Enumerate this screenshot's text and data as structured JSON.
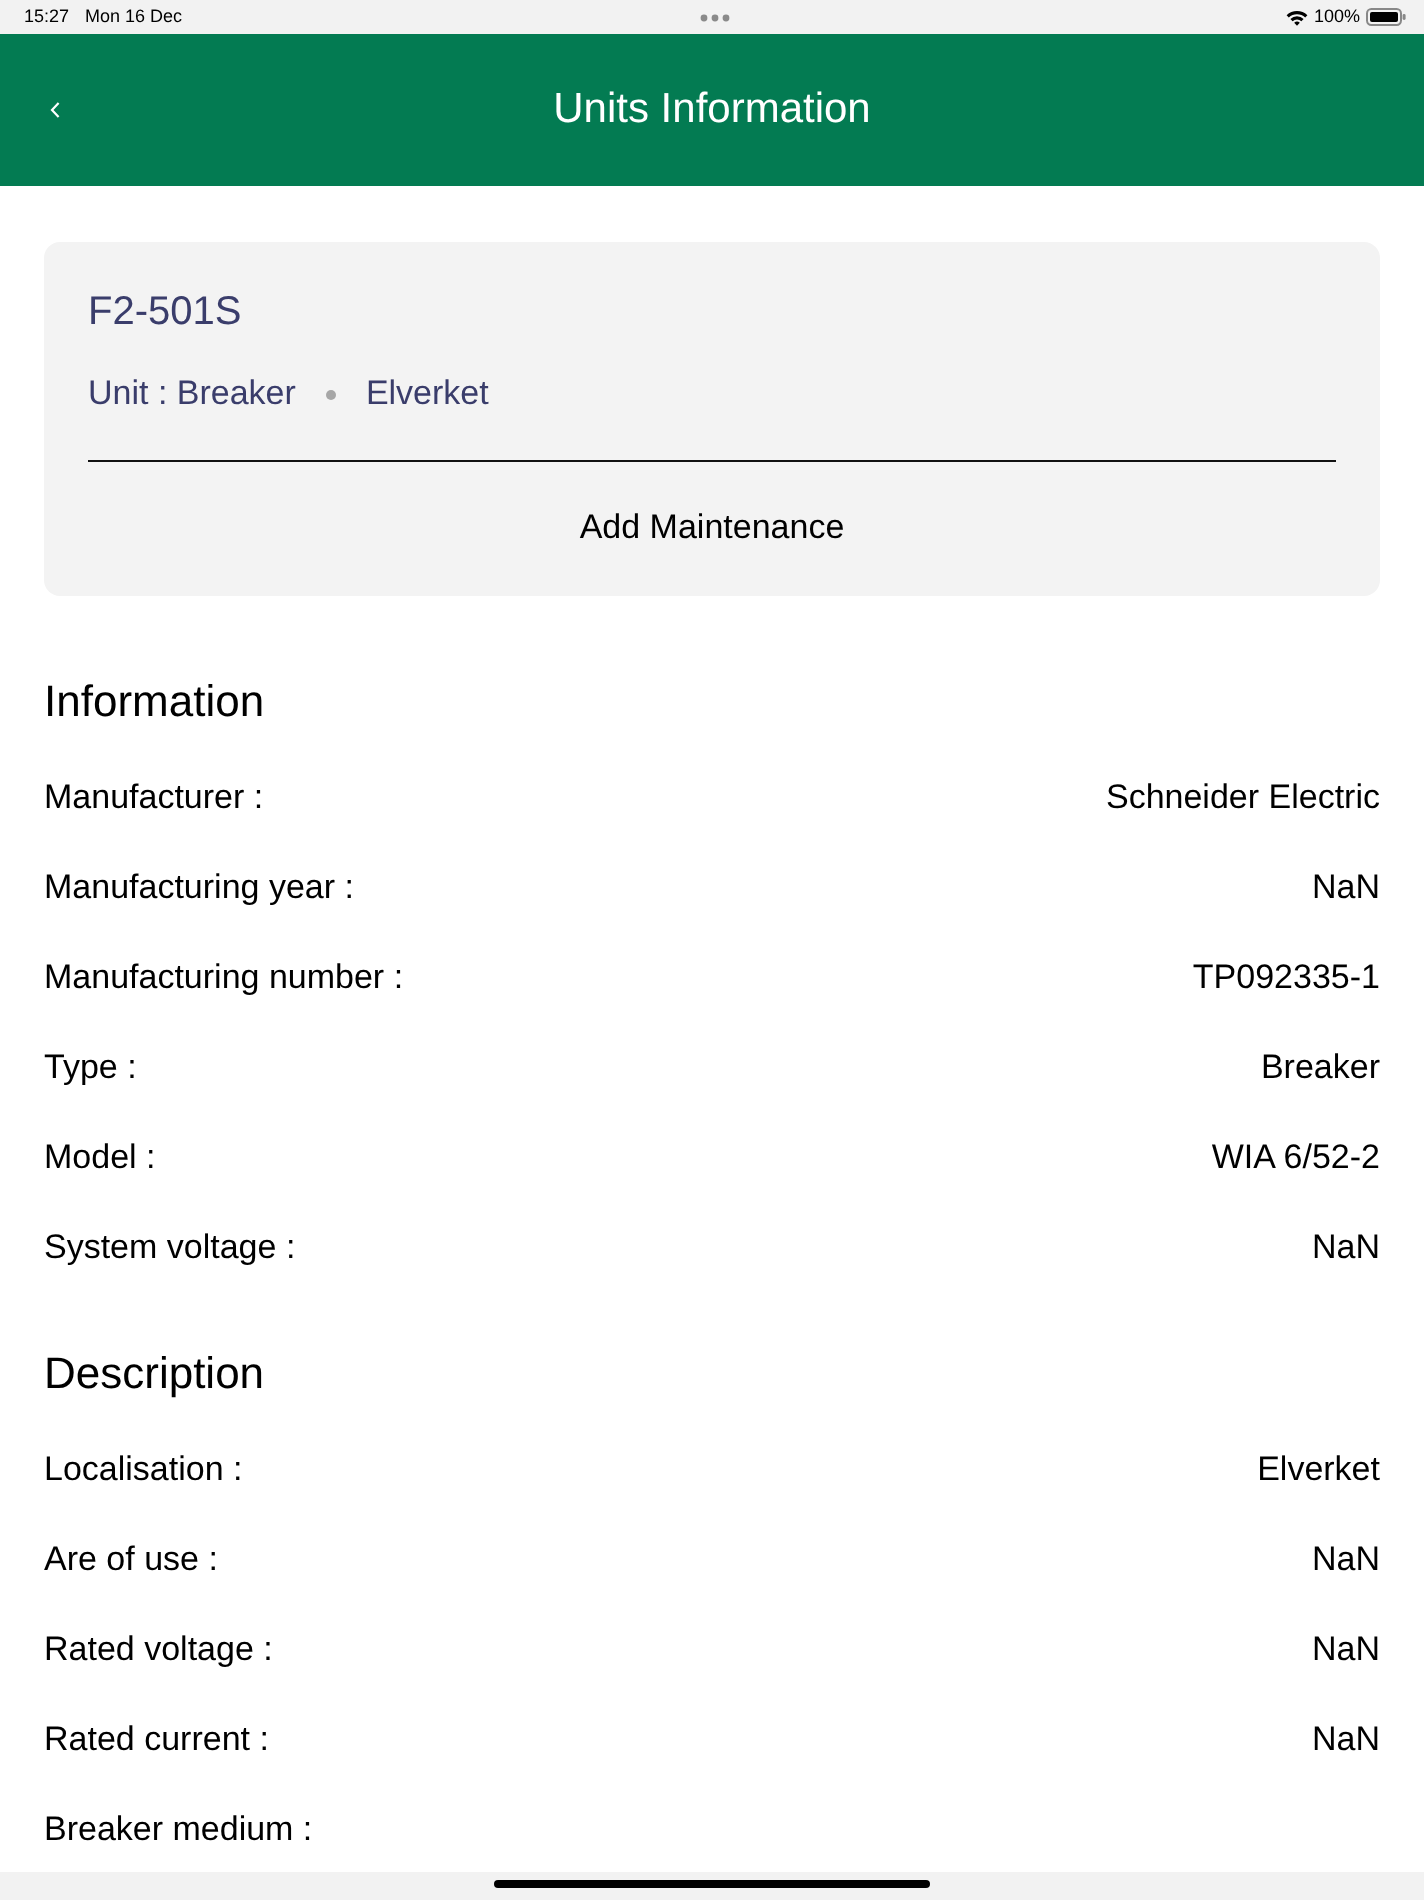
{
  "status_bar": {
    "time": "15:27",
    "date": "Mon 16 Dec",
    "battery": "100%"
  },
  "header": {
    "title": "Units Information"
  },
  "unit_card": {
    "name": "F2-501S",
    "unit": "Unit : Breaker",
    "location": "Elverket",
    "action": "Add Maintenance"
  },
  "sections": [
    {
      "title": "Information",
      "rows": [
        {
          "label": "Manufacturer :",
          "value": "Schneider Electric"
        },
        {
          "label": "Manufacturing year :",
          "value": "NaN"
        },
        {
          "label": "Manufacturing number :",
          "value": "TP092335-1"
        },
        {
          "label": "Type :",
          "value": "Breaker"
        },
        {
          "label": "Model :",
          "value": "WIA 6/52-2"
        },
        {
          "label": "System voltage :",
          "value": "NaN"
        }
      ]
    },
    {
      "title": "Description",
      "rows": [
        {
          "label": "Localisation :",
          "value": "Elverket"
        },
        {
          "label": "Are of use :",
          "value": "NaN"
        },
        {
          "label": "Rated voltage :",
          "value": "NaN"
        },
        {
          "label": "Rated current :",
          "value": "NaN"
        },
        {
          "label": "Breaker medium :"
        }
      ]
    }
  ]
}
